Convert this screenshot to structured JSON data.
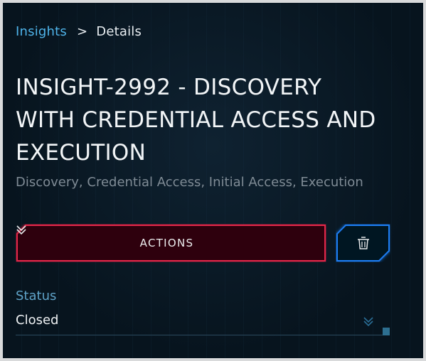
{
  "breadcrumb": {
    "parent": "Insights",
    "separator": ">",
    "current": "Details"
  },
  "insight": {
    "title": "INSIGHT-2992 - DISCOVERY WITH CREDENTIAL ACCESS AND EXECUTION",
    "tactics": "Discovery, Credential Access, Initial Access, Execution"
  },
  "actions_button": {
    "label": "ACTIONS",
    "icon": "double-chevron-down-icon"
  },
  "delete_button": {
    "icon": "trash-icon"
  },
  "status": {
    "label": "Status",
    "value": "Closed",
    "icon": "double-chevron-down-icon"
  },
  "colors": {
    "background": "#07141e",
    "link": "#4fb4ea",
    "actions_border": "#e0284a",
    "actions_fill": "#2e0610",
    "delete_border": "#1f7bf0",
    "status_label": "#5fa3c8"
  }
}
